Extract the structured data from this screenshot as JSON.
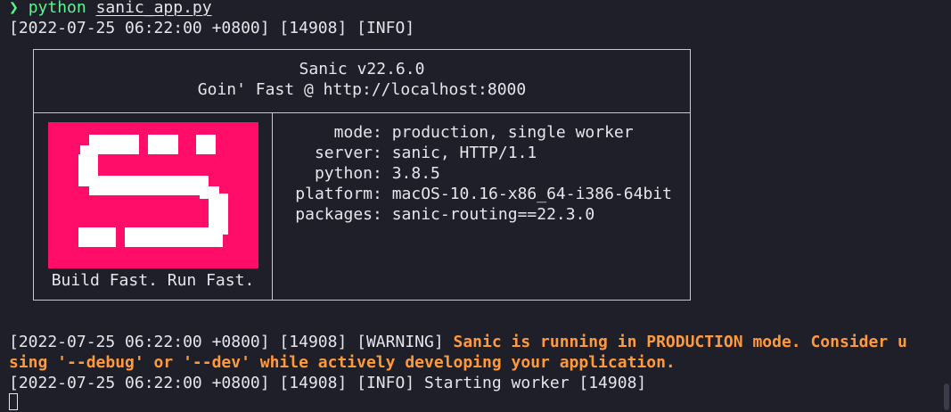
{
  "prompt": {
    "symbol": "❯",
    "command": "python",
    "argument": "sanic_app.py"
  },
  "log1": "[2022-07-25 06:22:00 +0800] [14908] [INFO]",
  "banner": {
    "title": "Sanic v22.6.0",
    "subtitle": "Goin' Fast @ http://localhost:8000",
    "tagline": "Build Fast. Run Fast.",
    "brand_color": "#ff0d68",
    "info": [
      {
        "key": "mode",
        "value": "production, single worker"
      },
      {
        "key": "server",
        "value": "sanic, HTTP/1.1"
      },
      {
        "key": "python",
        "value": "3.8.5"
      },
      {
        "key": "platform",
        "value": "macOS-10.16-x86_64-i386-64bit"
      },
      {
        "key": "packages",
        "value": "sanic-routing==22.3.0"
      }
    ]
  },
  "warning": {
    "prefix": "[2022-07-25 06:22:00 +0800] [14908] [WARNING] ",
    "message_line1": "Sanic is running in PRODUCTION mode. Consider u",
    "message_line2": "sing '--debug' or '--dev' while actively developing your application.",
    "color": "#ff9a3c"
  },
  "log2": "[2022-07-25 06:22:00 +0800] [14908] [INFO] Starting worker [14908]"
}
